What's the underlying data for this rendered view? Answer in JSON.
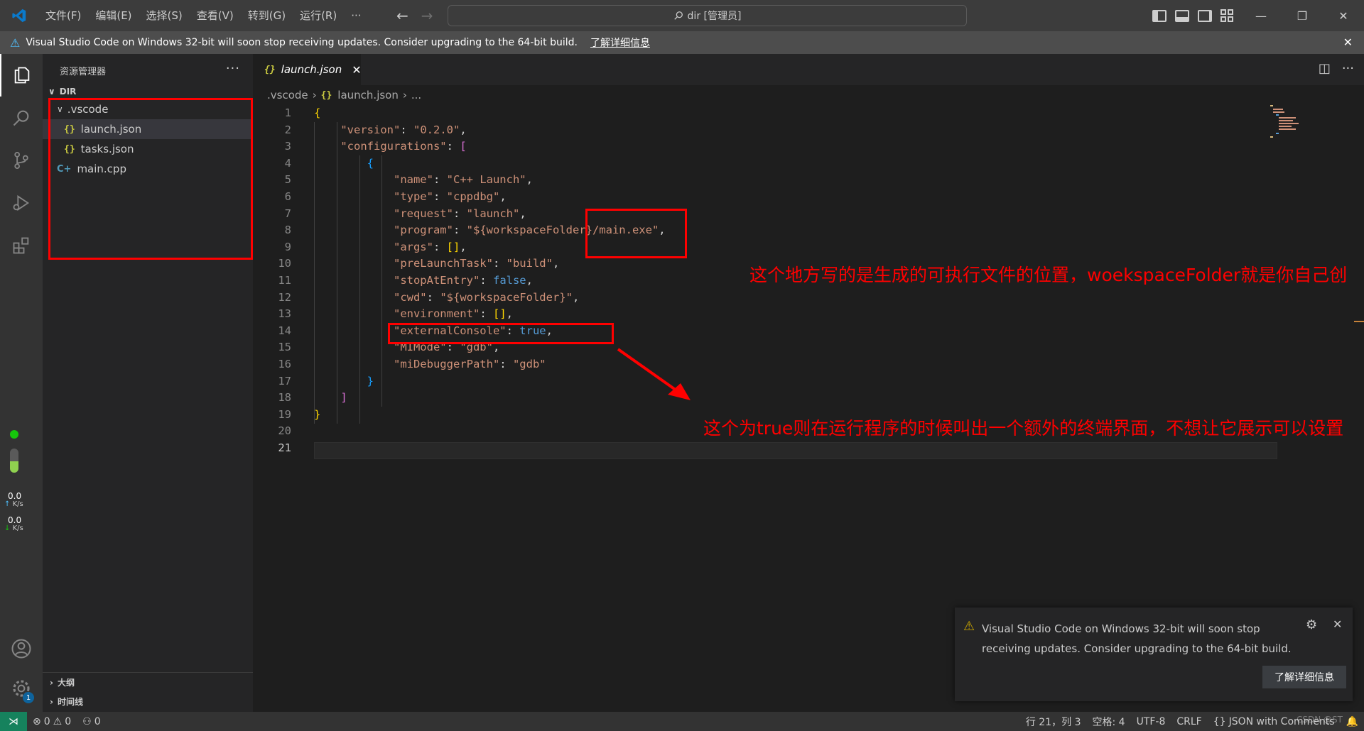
{
  "titlebar": {
    "menu": [
      "文件(F)",
      "编辑(E)",
      "选择(S)",
      "查看(V)",
      "转到(G)",
      "运行(R)",
      "···"
    ],
    "search": "dir [管理员]"
  },
  "banner": {
    "text": "Visual Studio Code on Windows 32-bit will soon stop receiving updates. Consider upgrading to the 64-bit build.",
    "link": "了解详细信息"
  },
  "sidebar": {
    "title": "资源管理器",
    "more": "···",
    "root": "DIR",
    "folder": ".vscode",
    "files": [
      "launch.json",
      "tasks.json"
    ],
    "root_file": "main.cpp",
    "outline": "大纲",
    "timeline": "时间线"
  },
  "activity": {
    "net_up": "0.0",
    "net_up_unit": "K/s",
    "net_down": "0.0",
    "net_down_unit": "K/s",
    "settings_badge": "1"
  },
  "editor": {
    "tab": "launch.json",
    "breadcrumb": [
      ".vscode",
      "launch.json",
      "..."
    ],
    "line_numbers": [
      "1",
      "2",
      "3",
      "4",
      "5",
      "6",
      "7",
      "8",
      "9",
      "10",
      "11",
      "12",
      "13",
      "14",
      "15",
      "16",
      "17",
      "18",
      "19",
      "20",
      "21"
    ]
  },
  "annotations": {
    "note1": "这个地方写的是生成的可执行文件的位置，woekspaceFolder就是你自己创",
    "note2": "这个为true则在运行程序的时候叫出一个额外的终端界面，不想让它展示可以设置"
  },
  "toast": {
    "message": "Visual Studio Code on Windows 32-bit will soon stop receiving updates. Consider upgrading to the 64-bit build.",
    "button": "了解详细信息"
  },
  "statusbar": {
    "errors": "0",
    "warnings": "0",
    "ports": "0",
    "position": "行 21，列 3",
    "spaces": "空格: 4",
    "encoding": "UTF-8",
    "eol": "CRLF",
    "language": "JSON with Comments",
    "watermark": "CSDN @ST"
  }
}
